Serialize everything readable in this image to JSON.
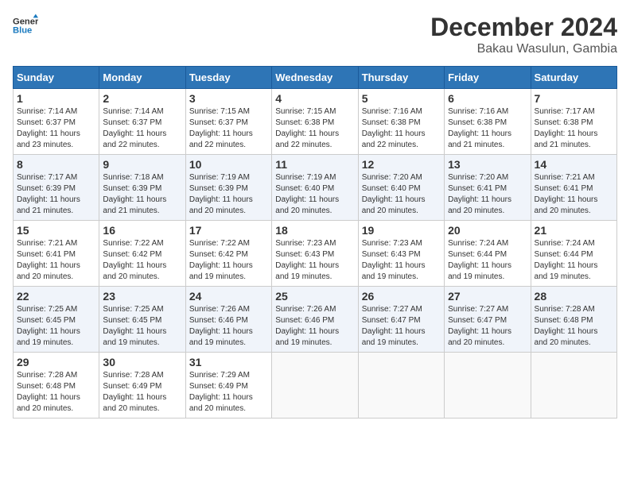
{
  "logo": {
    "line1": "General",
    "line2": "Blue"
  },
  "title": "December 2024",
  "subtitle": "Bakau Wasulun, Gambia",
  "days_of_week": [
    "Sunday",
    "Monday",
    "Tuesday",
    "Wednesday",
    "Thursday",
    "Friday",
    "Saturday"
  ],
  "weeks": [
    [
      {
        "day": "1",
        "info": "Sunrise: 7:14 AM\nSunset: 6:37 PM\nDaylight: 11 hours\nand 23 minutes."
      },
      {
        "day": "2",
        "info": "Sunrise: 7:14 AM\nSunset: 6:37 PM\nDaylight: 11 hours\nand 22 minutes."
      },
      {
        "day": "3",
        "info": "Sunrise: 7:15 AM\nSunset: 6:37 PM\nDaylight: 11 hours\nand 22 minutes."
      },
      {
        "day": "4",
        "info": "Sunrise: 7:15 AM\nSunset: 6:38 PM\nDaylight: 11 hours\nand 22 minutes."
      },
      {
        "day": "5",
        "info": "Sunrise: 7:16 AM\nSunset: 6:38 PM\nDaylight: 11 hours\nand 22 minutes."
      },
      {
        "day": "6",
        "info": "Sunrise: 7:16 AM\nSunset: 6:38 PM\nDaylight: 11 hours\nand 21 minutes."
      },
      {
        "day": "7",
        "info": "Sunrise: 7:17 AM\nSunset: 6:38 PM\nDaylight: 11 hours\nand 21 minutes."
      }
    ],
    [
      {
        "day": "8",
        "info": "Sunrise: 7:17 AM\nSunset: 6:39 PM\nDaylight: 11 hours\nand 21 minutes."
      },
      {
        "day": "9",
        "info": "Sunrise: 7:18 AM\nSunset: 6:39 PM\nDaylight: 11 hours\nand 21 minutes."
      },
      {
        "day": "10",
        "info": "Sunrise: 7:19 AM\nSunset: 6:39 PM\nDaylight: 11 hours\nand 20 minutes."
      },
      {
        "day": "11",
        "info": "Sunrise: 7:19 AM\nSunset: 6:40 PM\nDaylight: 11 hours\nand 20 minutes."
      },
      {
        "day": "12",
        "info": "Sunrise: 7:20 AM\nSunset: 6:40 PM\nDaylight: 11 hours\nand 20 minutes."
      },
      {
        "day": "13",
        "info": "Sunrise: 7:20 AM\nSunset: 6:41 PM\nDaylight: 11 hours\nand 20 minutes."
      },
      {
        "day": "14",
        "info": "Sunrise: 7:21 AM\nSunset: 6:41 PM\nDaylight: 11 hours\nand 20 minutes."
      }
    ],
    [
      {
        "day": "15",
        "info": "Sunrise: 7:21 AM\nSunset: 6:41 PM\nDaylight: 11 hours\nand 20 minutes."
      },
      {
        "day": "16",
        "info": "Sunrise: 7:22 AM\nSunset: 6:42 PM\nDaylight: 11 hours\nand 20 minutes."
      },
      {
        "day": "17",
        "info": "Sunrise: 7:22 AM\nSunset: 6:42 PM\nDaylight: 11 hours\nand 19 minutes."
      },
      {
        "day": "18",
        "info": "Sunrise: 7:23 AM\nSunset: 6:43 PM\nDaylight: 11 hours\nand 19 minutes."
      },
      {
        "day": "19",
        "info": "Sunrise: 7:23 AM\nSunset: 6:43 PM\nDaylight: 11 hours\nand 19 minutes."
      },
      {
        "day": "20",
        "info": "Sunrise: 7:24 AM\nSunset: 6:44 PM\nDaylight: 11 hours\nand 19 minutes."
      },
      {
        "day": "21",
        "info": "Sunrise: 7:24 AM\nSunset: 6:44 PM\nDaylight: 11 hours\nand 19 minutes."
      }
    ],
    [
      {
        "day": "22",
        "info": "Sunrise: 7:25 AM\nSunset: 6:45 PM\nDaylight: 11 hours\nand 19 minutes."
      },
      {
        "day": "23",
        "info": "Sunrise: 7:25 AM\nSunset: 6:45 PM\nDaylight: 11 hours\nand 19 minutes."
      },
      {
        "day": "24",
        "info": "Sunrise: 7:26 AM\nSunset: 6:46 PM\nDaylight: 11 hours\nand 19 minutes."
      },
      {
        "day": "25",
        "info": "Sunrise: 7:26 AM\nSunset: 6:46 PM\nDaylight: 11 hours\nand 19 minutes."
      },
      {
        "day": "26",
        "info": "Sunrise: 7:27 AM\nSunset: 6:47 PM\nDaylight: 11 hours\nand 19 minutes."
      },
      {
        "day": "27",
        "info": "Sunrise: 7:27 AM\nSunset: 6:47 PM\nDaylight: 11 hours\nand 20 minutes."
      },
      {
        "day": "28",
        "info": "Sunrise: 7:28 AM\nSunset: 6:48 PM\nDaylight: 11 hours\nand 20 minutes."
      }
    ],
    [
      {
        "day": "29",
        "info": "Sunrise: 7:28 AM\nSunset: 6:48 PM\nDaylight: 11 hours\nand 20 minutes."
      },
      {
        "day": "30",
        "info": "Sunrise: 7:28 AM\nSunset: 6:49 PM\nDaylight: 11 hours\nand 20 minutes."
      },
      {
        "day": "31",
        "info": "Sunrise: 7:29 AM\nSunset: 6:49 PM\nDaylight: 11 hours\nand 20 minutes."
      },
      null,
      null,
      null,
      null
    ]
  ]
}
